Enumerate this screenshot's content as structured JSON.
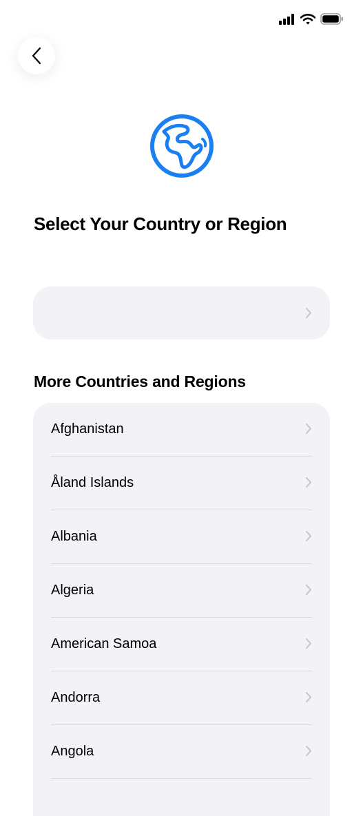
{
  "status_bar": {
    "icons": [
      "cellular-signal-icon",
      "wifi-icon",
      "battery-icon"
    ]
  },
  "navigation": {
    "back_icon": "chevron-left-icon"
  },
  "header": {
    "icon": "globe-icon",
    "icon_color": "#1a7ff0",
    "title": "Select Your Country or Region"
  },
  "selected_country": {
    "label": "",
    "icon": "chevron-right-icon"
  },
  "more_section": {
    "title": "More Countries and Regions",
    "items": [
      {
        "label": "Afghanistan"
      },
      {
        "label": "Åland Islands"
      },
      {
        "label": "Albania"
      },
      {
        "label": "Algeria"
      },
      {
        "label": "American Samoa"
      },
      {
        "label": "Andorra"
      },
      {
        "label": "Angola"
      }
    ]
  },
  "colors": {
    "row_background": "#f2f2f7",
    "chevron": "#c4c4c9",
    "divider": "#dadade"
  }
}
